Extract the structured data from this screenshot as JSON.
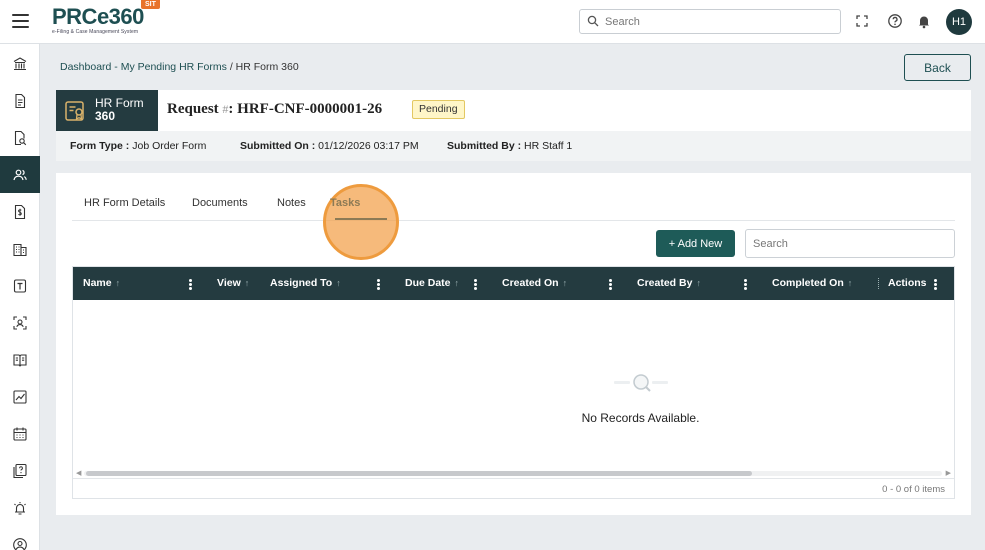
{
  "app": {
    "logo_text": "PRCe360",
    "logo_subtitle": "e-Filing & Case Management System",
    "env_badge": "SIT",
    "search_placeholder": "Search",
    "user_initials": "H1"
  },
  "sidebar": {
    "items": [
      {
        "icon": "bank-icon",
        "active": false
      },
      {
        "icon": "document-icon",
        "active": false
      },
      {
        "icon": "document-search-icon",
        "active": false
      },
      {
        "icon": "users-icon",
        "active": true
      },
      {
        "icon": "dollar-document-icon",
        "active": false
      },
      {
        "icon": "building-icon",
        "active": false
      },
      {
        "icon": "text-box-icon",
        "active": false
      },
      {
        "icon": "scan-user-icon",
        "active": false
      },
      {
        "icon": "book-icon",
        "active": false
      },
      {
        "icon": "chart-icon",
        "active": false
      },
      {
        "icon": "calendar-icon",
        "active": false
      },
      {
        "icon": "help-document-icon",
        "active": false
      },
      {
        "icon": "alarm-icon",
        "active": false
      },
      {
        "icon": "user-circle-icon",
        "active": false
      }
    ]
  },
  "breadcrumb": {
    "link": "Dashboard - My Pending HR Forms",
    "separator": "/",
    "current": "HR Form 360"
  },
  "back_label": "Back",
  "header": {
    "form_tag_line1": "HR Form",
    "form_tag_line2": "360",
    "request_prefix": "Request",
    "request_hash": "#",
    "request_id": ": HRF-CNF-0000001-26",
    "status": "Pending"
  },
  "meta": {
    "form_type_label": "Form Type :",
    "form_type_value": "Job Order Form",
    "submitted_on_label": "Submitted On :",
    "submitted_on_value": "01/12/2026 03:17 PM",
    "submitted_by_label": "Submitted By :",
    "submitted_by_value": "HR Staff 1"
  },
  "tabs": [
    {
      "label": "HR Form Details",
      "active": false
    },
    {
      "label": "Documents",
      "active": false
    },
    {
      "label": "Notes",
      "active": false
    },
    {
      "label": "Tasks",
      "active": true
    }
  ],
  "tasks": {
    "add_label": "+ Add New",
    "search_placeholder": "Search",
    "columns": [
      {
        "label": "Name",
        "sortable": true
      },
      {
        "label": "View",
        "sortable": true
      },
      {
        "label": "Assigned To",
        "sortable": true
      },
      {
        "label": "Due Date",
        "sortable": true
      },
      {
        "label": "Created On",
        "sortable": true
      },
      {
        "label": "Created By",
        "sortable": true
      },
      {
        "label": "Completed On",
        "sortable": true
      },
      {
        "label": "Actions",
        "sortable": false
      }
    ],
    "sort_arrow": "↑",
    "empty_text": "No Records Available.",
    "pager_text": "0 - 0 of 0 items"
  },
  "colors": {
    "primary": "#1f3a3e",
    "accent_button": "#1e5b58",
    "active_tab": "#8c7a55",
    "pending_badge": "#fff6c8",
    "env_badge": "#e8732b"
  }
}
